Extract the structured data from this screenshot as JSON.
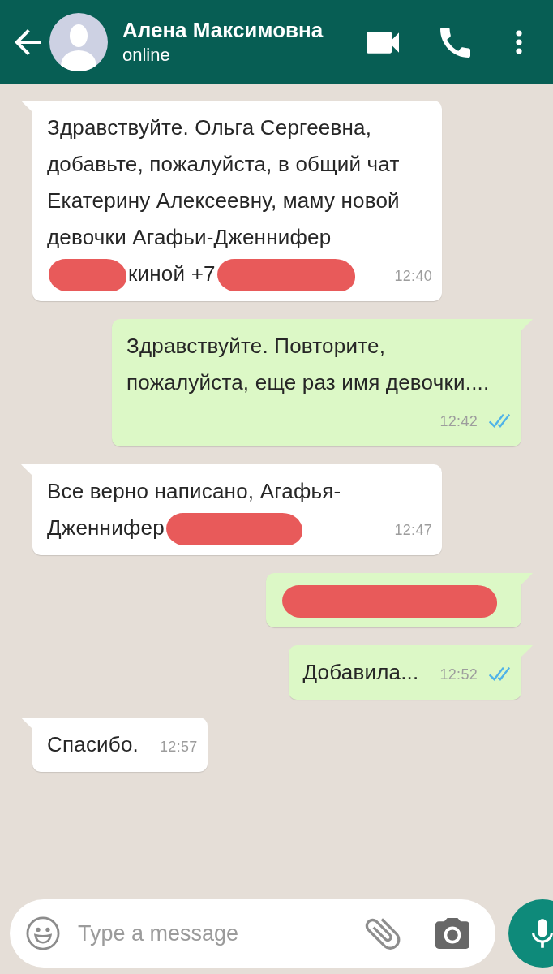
{
  "header": {
    "contact_name": "Алена Максимовна",
    "status": "online"
  },
  "messages": [
    {
      "kind": "incoming",
      "segments": [
        {
          "kind": "text",
          "text": "Здравствуйте. Ольга Сергеевна, добавьте, пожалуйста, в общий чат Екатерину Алексеевну, маму новой девочки Агафьи-Дженнифер"
        },
        {
          "kind": "short_redaction"
        },
        {
          "kind": "text",
          "text": "киной +7"
        },
        {
          "kind": "long_redaction"
        }
      ],
      "time": "12:40"
    },
    {
      "kind": "outgoing",
      "segments": [
        {
          "kind": "text",
          "text": "Здравствуйте. Повторите, пожалуйста, еще раз имя девочки...."
        }
      ],
      "time": "12:42",
      "read": true
    },
    {
      "kind": "incoming",
      "segments": [
        {
          "kind": "text",
          "text": "Все верно написано, Агафья-Дженнифер"
        },
        {
          "kind": "redaction"
        }
      ],
      "time": "12:47"
    },
    {
      "kind": "outgoing",
      "segments": [
        {
          "kind": "line_redaction"
        }
      ]
    },
    {
      "kind": "outgoing",
      "segments": [
        {
          "kind": "text",
          "text": "Добавила..."
        }
      ],
      "time": "12:52",
      "read": true
    },
    {
      "kind": "incoming",
      "segments": [
        {
          "kind": "text",
          "text": "Спасибо."
        }
      ],
      "time": "12:57"
    }
  ],
  "composer": {
    "placeholder": "Type a message"
  }
}
